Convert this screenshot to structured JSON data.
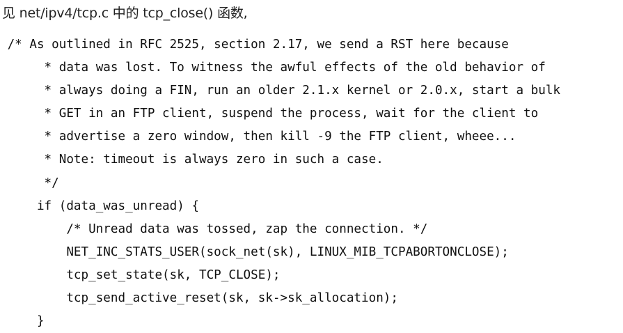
{
  "intro": "见 net/ipv4/tcp.c 中的 tcp_close() 函数,",
  "code_lines": [
    " /* As outlined in RFC 2525, section 2.17, we send a RST here because",
    "      * data was lost. To witness the awful effects of the old behavior of",
    "      * always doing a FIN, run an older 2.1.x kernel or 2.0.x, start a bulk",
    "      * GET in an FTP client, suspend the process, wait for the client to",
    "      * advertise a zero window, then kill -9 the FTP client, wheee...",
    "      * Note: timeout is always zero in such a case.",
    "      */",
    "     if (data_was_unread) {",
    "         /* Unread data was tossed, zap the connection. */",
    "         NET_INC_STATS_USER(sock_net(sk), LINUX_MIB_TCPABORTONCLOSE);",
    "         tcp_set_state(sk, TCP_CLOSE);",
    "         tcp_send_active_reset(sk, sk->sk_allocation);",
    "     }"
  ]
}
